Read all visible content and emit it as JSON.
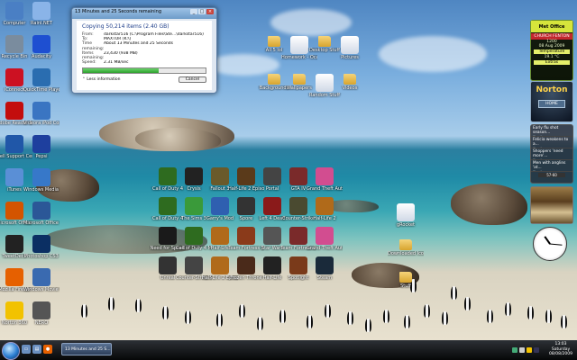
{
  "desktop_icons_left": [
    {
      "label": "Computer",
      "icon": "computer-icon",
      "color": "#4a7fc4"
    },
    {
      "label": "Rainl.NET",
      "icon": "app-icon",
      "color": "#8ab4e8"
    },
    {
      "label": "Recycle Bin",
      "icon": "recycle-bin-icon",
      "color": "#7a8c9e"
    },
    {
      "label": "Audacity",
      "icon": "audacity-icon",
      "color": "#1e4fd1"
    },
    {
      "label": "iConnect",
      "icon": "iconnect-icon",
      "color": "#c12"
    },
    {
      "label": "QuickTime Player",
      "icon": "quicktime-icon",
      "color": "#2a6db0"
    },
    {
      "label": "Adobe Reader 9",
      "icon": "adobe-reader-icon",
      "color": "#c30d0d"
    },
    {
      "label": "Videora iPod Converter",
      "icon": "videora-icon",
      "color": "#3a75c2"
    },
    {
      "label": "Dell Support Center",
      "icon": "dell-icon",
      "color": "#2057a8"
    },
    {
      "label": "Pepsi",
      "icon": "pepsi-icon",
      "color": "#1e3f9e"
    },
    {
      "label": "iTunes",
      "icon": "itunes-icon",
      "color": "#5a8fd6"
    },
    {
      "label": "Windows Media Player",
      "icon": "media-player-icon",
      "color": "#3778c9"
    },
    {
      "label": "Microsoft Office Productivi...",
      "icon": "office-icon",
      "color": "#d35400"
    },
    {
      "label": "Microsoft Office Word",
      "icon": "word-icon",
      "color": "#2b5797"
    },
    {
      "label": "TweetDeck",
      "icon": "tweetdeck-icon",
      "color": "#222"
    },
    {
      "label": "Photoshop CS3",
      "icon": "photoshop-icon",
      "color": "#0b2f63"
    },
    {
      "label": "Mozilla Firefox",
      "icon": "firefox-icon",
      "color": "#e66000"
    },
    {
      "label": "Windows Movie Maker",
      "icon": "movie-maker-icon",
      "color": "#3a6ab0"
    },
    {
      "label": "Norton 360",
      "icon": "norton-icon",
      "color": "#f2c200"
    },
    {
      "label": "NERO",
      "icon": "nero-icon",
      "color": "#555"
    }
  ],
  "desktop_icons_top": [
    {
      "label": "All 5 lol",
      "icon": "folder-icon"
    },
    {
      "label": "Homework - Ocal",
      "icon": "file-icon"
    },
    {
      "label": "Desktop Stuff",
      "icon": "folder-icon"
    },
    {
      "label": "Pictures",
      "icon": "file-icon"
    },
    {
      "label": "Backgrounds",
      "icon": "folder-icon"
    },
    {
      "label": "Wallpapers",
      "icon": "folder-icon"
    },
    {
      "label": "Random Stuff",
      "icon": "file-icon"
    },
    {
      "label": "Videos",
      "icon": "folder-icon"
    }
  ],
  "desktop_icons_games": [
    {
      "label": "Call of Duty 4",
      "color": "#2e6b1f"
    },
    {
      "label": "Crysis",
      "color": "#222"
    },
    {
      "label": "Fallout 3",
      "color": "#6a5a2a"
    },
    {
      "label": "Half-Life 2 Episode One",
      "color": "#5a3a1a"
    },
    {
      "label": "Portal",
      "color": "#444"
    },
    {
      "label": "GTA IV",
      "color": "#7a2a2a"
    },
    {
      "label": "Grand Theft Auto",
      "color": "#d24d90"
    },
    {
      "label": "Call of Duty 4",
      "color": "#2e6b1f"
    },
    {
      "label": "The Sims 3",
      "color": "#3a9a3a"
    },
    {
      "label": "Garry's Mod",
      "color": "#2f5fb0"
    },
    {
      "label": "Spore",
      "color": "#333"
    },
    {
      "label": "Left 4 Dead",
      "color": "#8a1a1a"
    },
    {
      "label": "Counter-Strike",
      "color": "#4a4a30"
    },
    {
      "label": "Half-Life 2",
      "color": "#b06a1a"
    },
    {
      "label": "Need for Speed",
      "color": "#1a1a1a"
    },
    {
      "label": "Call of Duty 4 Multiplayer",
      "color": "#2e6b1f"
    },
    {
      "label": "Half-Life",
      "color": "#b06a1a"
    },
    {
      "label": "Team Fortress 2",
      "color": "#8a3a1a"
    },
    {
      "label": "Star Wars",
      "color": "#555"
    },
    {
      "label": "Team Fortress 2",
      "color": "#7a2a2a"
    },
    {
      "label": "Grand Theft Auto San An...",
      "color": "#d24d90"
    },
    {
      "label": "Unreal",
      "color": "#333"
    },
    {
      "label": "Counter-Strike Source",
      "color": "#444"
    },
    {
      "label": "Half-Life 2 Episode Two",
      "color": "#b06a1a"
    },
    {
      "label": "Frozen Throne",
      "color": "#4a2a1a"
    },
    {
      "label": "Half-Life",
      "color": "#222"
    },
    {
      "label": "Spotlight",
      "color": "#7a3a1a"
    },
    {
      "label": "Steam",
      "color": "#1a2a3a"
    }
  ],
  "desktop_icons_right": [
    {
      "label": "gRocket",
      "icon": "file-icon"
    },
    {
      "label": "Downloaded Icons",
      "icon": "folder-icon"
    },
    {
      "label": "Stuff",
      "icon": "folder-icon"
    }
  ],
  "dialog": {
    "title": "13 Minutes and 25 Seconds remaining",
    "heading": "Copying 50,214 items (2.40 GB)",
    "from_label": "From:",
    "from_value": "darkstar516 (C:\\Program Files\\Ste...\\darkstar516)",
    "to_label": "To:",
    "to_value": "MAXTOR (K:\\)",
    "time_label": "Time remaining:",
    "time_value": "About 13 Minutes and 25 Seconds",
    "items_label": "Items remaining:",
    "items_value": "23,430 (938 MB)",
    "speed_label": "Speed:",
    "speed_value": "2.31 MB/sec",
    "progress": 0.62,
    "less_info": "Less information",
    "cancel": "Cancel"
  },
  "weather": {
    "brand": "Met Office",
    "place": "CHURCH FENTON",
    "time": "1200",
    "date": "08 Aug 2009",
    "temp_label": "Temperature",
    "temp_value": "19.1 °C",
    "extras": "Extras"
  },
  "norton": {
    "brand": "Norton",
    "home": "HOME"
  },
  "news": {
    "items": [
      {
        "headline": "Early flu shot season...",
        "src": "The Age"
      },
      {
        "headline": "Felicia weakens to a...",
        "src": "The Age"
      },
      {
        "headline": "Shoppers 'need more'...",
        "src": "The Age"
      },
      {
        "headline": "Men with anglins 'at...",
        "src": "The Age"
      }
    ],
    "nav": "57-60"
  },
  "taskbar": {
    "task_label": "13 Minutes and 25 S...",
    "time": "13:03",
    "day": "Saturday",
    "date": "08/08/2009"
  }
}
